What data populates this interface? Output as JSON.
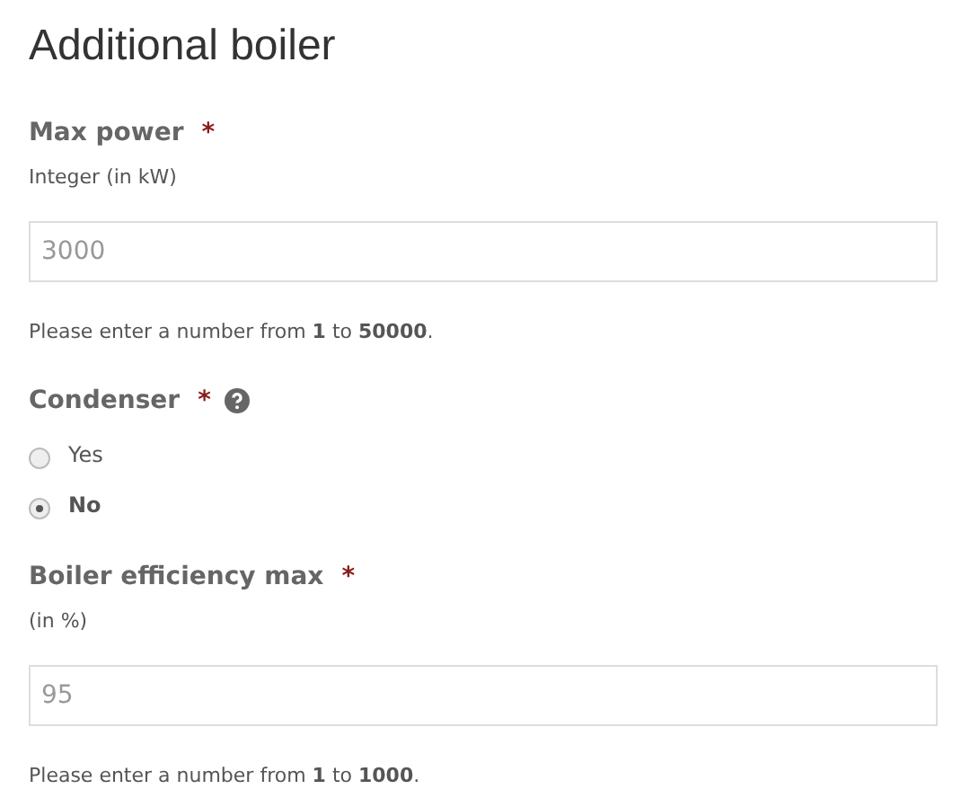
{
  "title": "Additional boiler",
  "fields": [
    {
      "kind": "number",
      "label": "Max power",
      "required_mark": "*",
      "hint": "Integer (in kW)",
      "placeholder": "3000",
      "help_text": "Please enter a number from **1** to **50000**."
    },
    {
      "kind": "radio",
      "label": "Condenser",
      "required_mark": "*",
      "help_icon": true,
      "options": [
        {
          "label": "Yes",
          "selected": false
        },
        {
          "label": "No",
          "selected": true
        }
      ]
    },
    {
      "kind": "number",
      "label": "Boiler efficiency max",
      "required_mark": "*",
      "hint": "(in %)",
      "placeholder": "95",
      "help_text": "Please enter a number from **1** to **1000**."
    }
  ]
}
